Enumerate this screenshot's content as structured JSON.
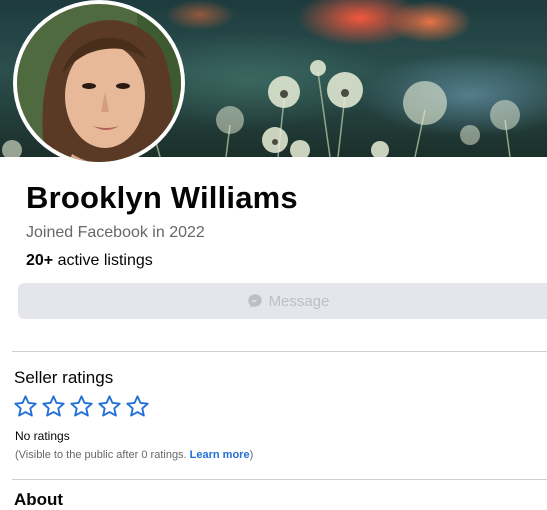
{
  "profile": {
    "name": "Brooklyn Williams",
    "joined": "Joined Facebook in 2022",
    "listings_count": "20+",
    "listings_label": " active listings"
  },
  "actions": {
    "message_label": "Message",
    "message_icon": "messenger-icon"
  },
  "seller_ratings": {
    "title": "Seller ratings",
    "stars_filled": 0,
    "stars_total": 5,
    "star_color": "#2270d5",
    "status": "No ratings",
    "note_prefix": "(Visible to the public after 0 ratings. ",
    "learn_more": "Learn more",
    "note_suffix": ")"
  },
  "about": {
    "title": "About"
  },
  "colors": {
    "message_bg": "#e4e6eb",
    "message_text": "#bcc0c4",
    "link": "#216fdb",
    "secondary_text": "#65676b"
  }
}
